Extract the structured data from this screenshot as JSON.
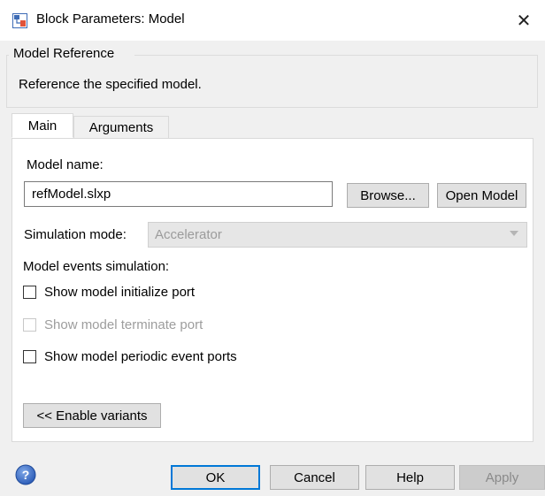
{
  "window": {
    "title": "Block Parameters: Model",
    "close_glyph": "✕",
    "icon": "simulink-block-icon"
  },
  "group": {
    "title": "Model Reference",
    "description": "Reference the specified model."
  },
  "tabs": [
    {
      "label": "Main",
      "active": true
    },
    {
      "label": "Arguments",
      "active": false
    }
  ],
  "main": {
    "model_name_label": "Model name:",
    "model_name_value": "refModel.slxp",
    "browse_label": "Browse...",
    "open_model_label": "Open Model",
    "simulation_mode_label": "Simulation mode:",
    "simulation_mode_value": "Accelerator",
    "events_label": "Model events simulation:",
    "checkboxes": [
      {
        "label": "Show model initialize port",
        "checked": false,
        "enabled": true
      },
      {
        "label": "Show model terminate port",
        "checked": false,
        "enabled": false
      },
      {
        "label": "Show model periodic event ports",
        "checked": false,
        "enabled": true
      }
    ],
    "enable_variants_label": "<< Enable variants"
  },
  "footer": {
    "ok_label": "OK",
    "cancel_label": "Cancel",
    "help_label": "Help",
    "apply_label": "Apply"
  },
  "colors": {
    "focus_border": "#0078d7",
    "help_icon_blue": "#3b6fc2"
  }
}
